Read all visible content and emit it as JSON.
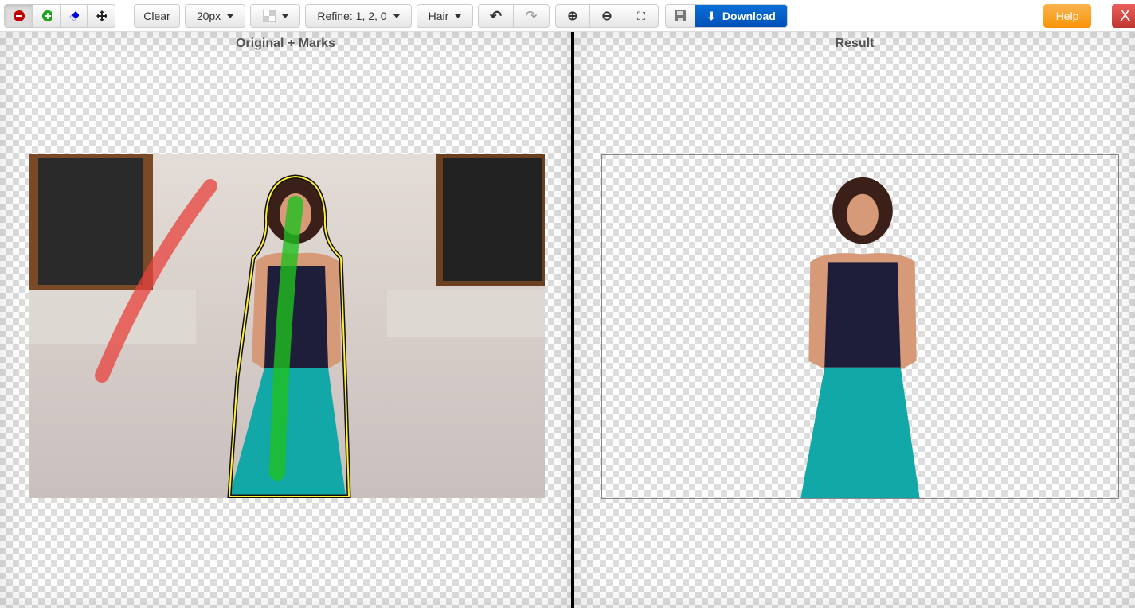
{
  "toolbar": {
    "tools": [
      {
        "name": "remove-marker",
        "icon": "minus-circle-icon",
        "color": "#c00000"
      },
      {
        "name": "keep-marker",
        "icon": "plus-circle-icon",
        "color": "#1aa51a"
      },
      {
        "name": "eraser",
        "icon": "eraser-icon",
        "color": "#0000dd"
      },
      {
        "name": "pan",
        "icon": "move-icon"
      }
    ],
    "clear_label": "Clear",
    "brush_size": "20px",
    "background_icon": "checkerboard-icon",
    "refine": "Refine: 1, 2, 0",
    "mode": "Hair",
    "download_label": "Download",
    "help_label": "Help",
    "close_label": "X"
  },
  "panels": {
    "left_title": "Original + Marks",
    "right_title": "Result"
  },
  "colors": {
    "remove_mark": "#e8413c",
    "keep_mark": "#1fbf1f",
    "outline": "#ffee33",
    "download": "#0a63cc",
    "help": "#f89406",
    "close": "#d9413d"
  }
}
